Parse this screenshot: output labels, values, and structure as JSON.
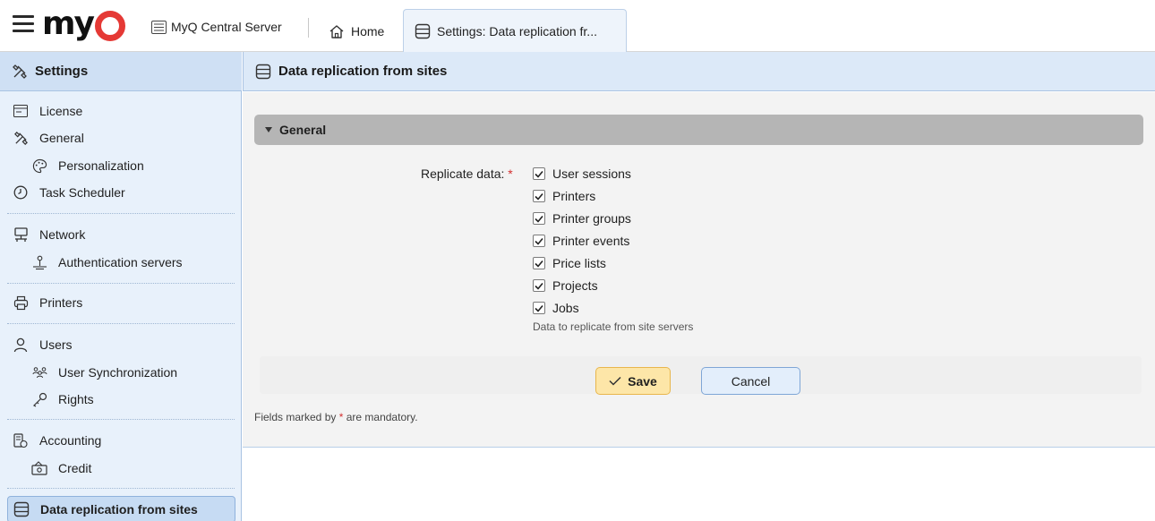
{
  "topbar": {
    "logo_text": "my",
    "server_name": "MyQ Central Server",
    "tabs": [
      {
        "label": "Home",
        "icon": "home-icon"
      },
      {
        "label": "Settings: Data replication fr...",
        "icon": "database-icon"
      }
    ]
  },
  "sidebar": {
    "title": "Settings",
    "items": [
      {
        "label": "License",
        "icon": "license-icon"
      },
      {
        "label": "General",
        "icon": "tools-icon"
      },
      {
        "label": "Personalization",
        "icon": "palette-icon"
      },
      {
        "label": "Task Scheduler",
        "icon": "clock-icon"
      },
      {
        "label": "Network",
        "icon": "network-icon"
      },
      {
        "label": "Authentication servers",
        "icon": "auth-server-icon"
      },
      {
        "label": "Printers",
        "icon": "printer-icon"
      },
      {
        "label": "Users",
        "icon": "user-icon"
      },
      {
        "label": "User Synchronization",
        "icon": "users-sync-icon"
      },
      {
        "label": "Rights",
        "icon": "key-icon"
      },
      {
        "label": "Accounting",
        "icon": "accounting-icon"
      },
      {
        "label": "Credit",
        "icon": "credit-icon"
      },
      {
        "label": "Data replication from sites",
        "icon": "database-icon",
        "active": true
      }
    ]
  },
  "main": {
    "title": "Data replication from sites",
    "section_title": "General",
    "field_label": "Replicate data:",
    "required_mark": "*",
    "options": [
      {
        "label": "User sessions",
        "checked": true
      },
      {
        "label": "Printers",
        "checked": true
      },
      {
        "label": "Printer groups",
        "checked": true
      },
      {
        "label": "Printer events",
        "checked": true
      },
      {
        "label": "Price lists",
        "checked": true
      },
      {
        "label": "Projects",
        "checked": true
      },
      {
        "label": "Jobs",
        "checked": true
      }
    ],
    "hint": "Data to replicate from site servers",
    "save_label": "Save",
    "cancel_label": "Cancel",
    "footnote_before": "Fields marked by",
    "footnote_after": "are mandatory."
  },
  "colors": {
    "accent_red": "#e53935",
    "header_blue": "#dce9f8",
    "sidebar_bg": "#e8f1fb",
    "save_bg": "#fde6a8"
  }
}
